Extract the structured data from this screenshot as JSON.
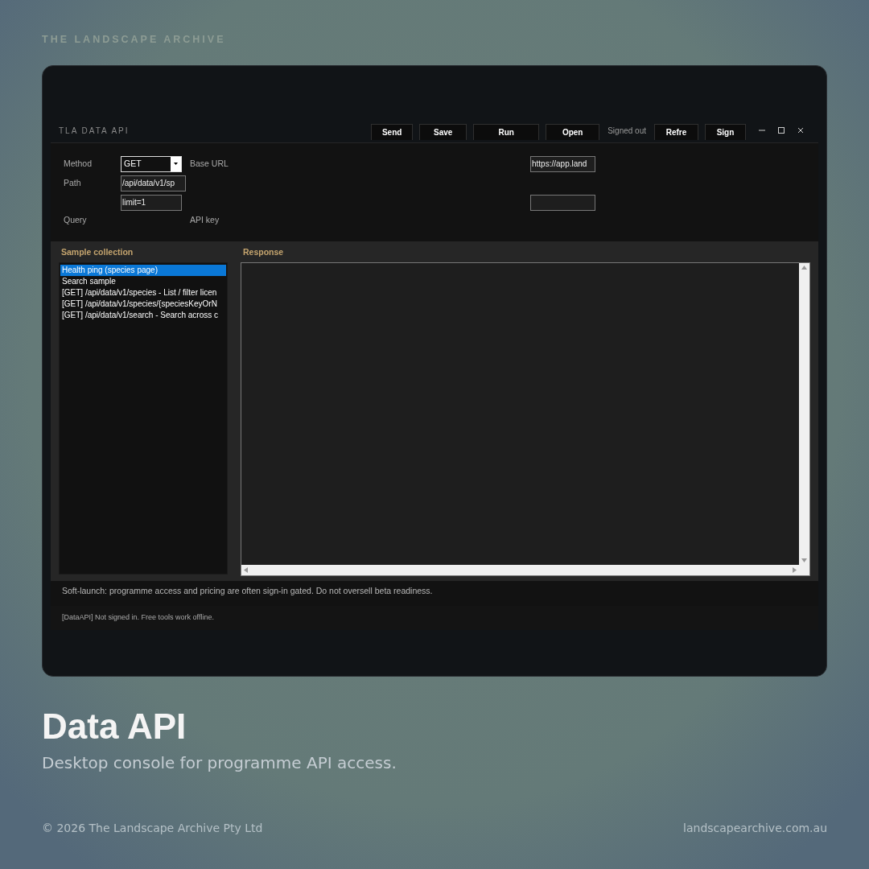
{
  "brand": "THE LANDSCAPE ARCHIVE",
  "app": {
    "title": "TLA DATA API",
    "toolbar": [
      {
        "kind": "button",
        "label": "Send"
      },
      {
        "kind": "button",
        "label": "Save"
      },
      {
        "kind": "button",
        "label": "Run"
      },
      {
        "kind": "button",
        "label": "Open"
      },
      {
        "kind": "status",
        "label": "Signed out"
      },
      {
        "kind": "button",
        "label": "Refre"
      },
      {
        "kind": "button",
        "label": "Sign"
      }
    ],
    "form": {
      "method": {
        "label": "Method",
        "value": "GET"
      },
      "base_url": {
        "label": "Base URL",
        "value": "https://app.land"
      },
      "path": {
        "label": "Path",
        "value": "/api/data/v1/sp"
      },
      "query": {
        "label": "Query",
        "value": "limit=1"
      },
      "api_key": {
        "label": "API key"
      }
    },
    "collection": {
      "title": "Sample collection",
      "items": [
        {
          "label": "Health ping (species page)",
          "selected": true
        },
        {
          "label": "Search sample",
          "selected": false
        },
        {
          "label": "[GET] /api/data/v1/species - List / filter licen",
          "selected": false
        },
        {
          "label": "[GET] /api/data/v1/species/{speciesKeyOrN",
          "selected": false
        },
        {
          "label": "[GET] /api/data/v1/search - Search across c",
          "selected": false
        }
      ]
    },
    "response": {
      "title": "Response"
    },
    "notice": "Soft-launch: programme access and pricing are often sign-in gated. Do not oversell beta readiness.",
    "log": "[DataAPI] Not signed in. Free tools work offline."
  },
  "headline": "Data API",
  "subtitle": "Desktop console for programme API access.",
  "footer": {
    "copyright": "© 2026 The Landscape Archive Pty Ltd",
    "website": "landscapearchive.com.au"
  }
}
